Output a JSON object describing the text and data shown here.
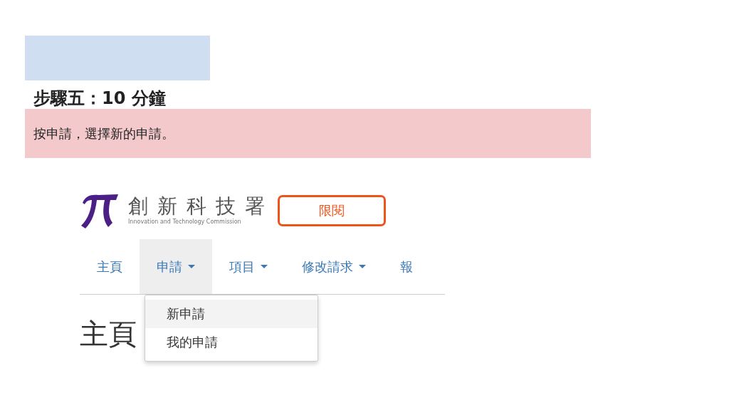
{
  "slide": {
    "title": "步驟五：10 分鐘",
    "instruction": "按申請，選擇新的申請。"
  },
  "site": {
    "logo_name": "創 新 科 技 署",
    "logo_subtitle": "Innovation and Technology Commission",
    "badge": "限閱",
    "nav": [
      {
        "label": "主頁",
        "dropdown": false,
        "selected": false
      },
      {
        "label": "申請",
        "dropdown": true,
        "selected": true
      },
      {
        "label": "項目",
        "dropdown": true,
        "selected": false
      },
      {
        "label": "修改請求",
        "dropdown": true,
        "selected": false
      },
      {
        "label": "報",
        "dropdown": false,
        "selected": false
      }
    ],
    "menu": [
      {
        "label": "新申請",
        "selected": true
      },
      {
        "label": "我的申請",
        "selected": false
      }
    ],
    "page_heading": "主頁"
  }
}
